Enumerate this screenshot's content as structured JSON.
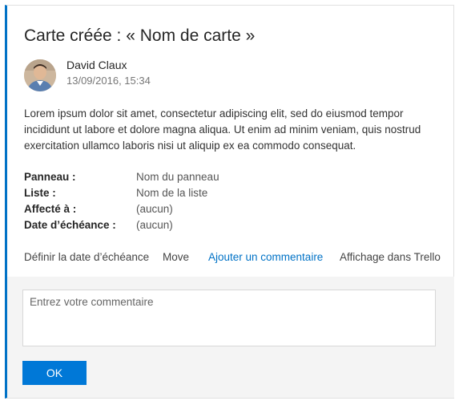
{
  "card": {
    "title": "Carte créée : « Nom de carte »",
    "author": {
      "name": "David Claux",
      "timestamp": "13/09/2016, 15:34",
      "avatar_icon": "person-avatar"
    },
    "description": "Lorem ipsum dolor sit amet, consectetur adipiscing elit, sed do eiusmod tempor incididunt ut labore et dolore magna aliqua. Ut enim ad minim veniam, quis nostrud exercitation ullamco laboris nisi ut aliquip ex ea commodo consequat.",
    "fields": [
      {
        "label": "Panneau :",
        "value": "Nom du panneau"
      },
      {
        "label": "Liste :",
        "value": "Nom de la liste"
      },
      {
        "label": "Affecté à :",
        "value": "(aucun)"
      },
      {
        "label": "Date d’échéance :",
        "value": "(aucun)"
      }
    ],
    "actions": [
      {
        "label": "Définir la date d’échéance"
      },
      {
        "label": "Move"
      },
      {
        "label": "Ajouter un commentaire"
      },
      {
        "label": "Affichage dans Trello"
      }
    ]
  },
  "comment": {
    "placeholder": "Entrez votre commentaire",
    "value": "",
    "submit_label": "OK"
  },
  "colors": {
    "accent": "#0072c6",
    "button": "#0078d7",
    "panel_background": "#f4f4f4"
  }
}
